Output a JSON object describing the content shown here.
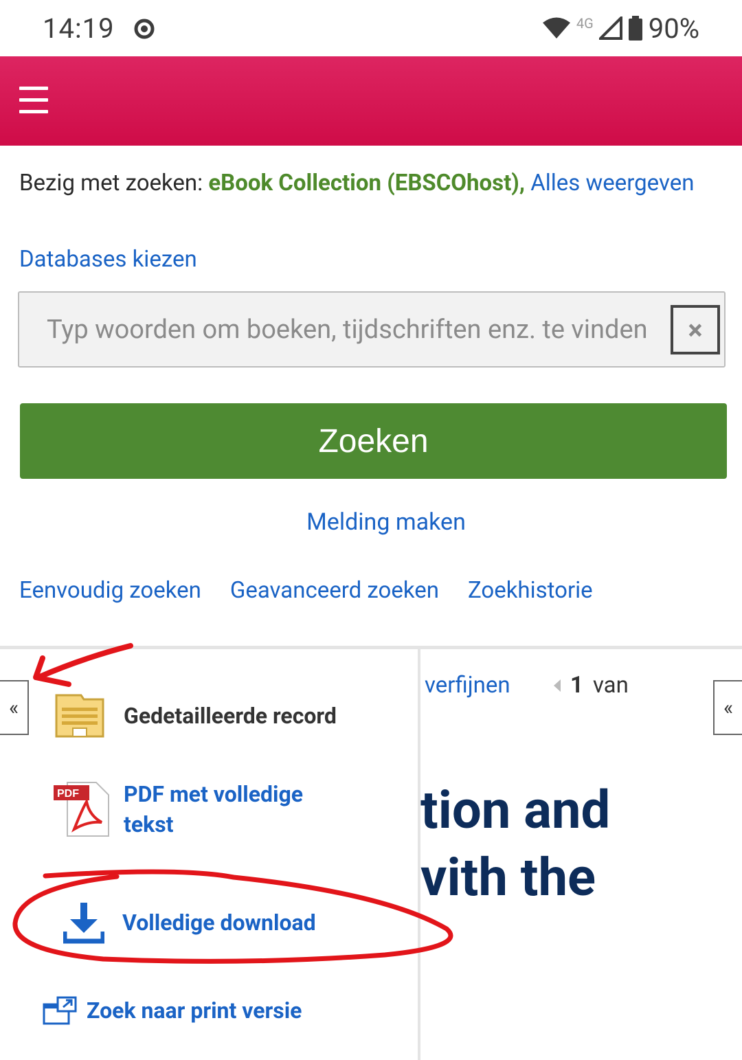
{
  "status_bar": {
    "time": "14:19",
    "network": "4G",
    "battery": "90%"
  },
  "header": {
    "menu_icon": "hamburger-menu-icon",
    "color": "#d4174f"
  },
  "search": {
    "searching_label": "Bezig met zoeken:",
    "database": "eBook Collection (EBSCOhost),",
    "show_all": "Alles weergeven",
    "choose_databases": "Databases kiezen",
    "placeholder": "Typ woorden om boeken, tijdschriften enz. te vinden",
    "clear_label": "×",
    "submit_label": "Zoeken",
    "notify_label": "Melding maken"
  },
  "nav": {
    "basic": "Eenvoudig zoeken",
    "advanced": "Geavanceerd zoeken",
    "history": "Zoekhistorie"
  },
  "result_view": {
    "refine_fragment": "verfijnen",
    "page_current": "1",
    "page_of": "van",
    "title_line1": "tion and",
    "title_line2": "vith the"
  },
  "panel": {
    "collapse_glyph": "«",
    "items": [
      {
        "label": "Gedetailleerde record",
        "icon": "detailed-record-icon"
      },
      {
        "label": "PDF met volledige tekst",
        "icon": "pdf-icon"
      },
      {
        "label": "Volledige download",
        "icon": "download-icon"
      },
      {
        "label": "Zoek naar print versie",
        "icon": "print-version-icon"
      }
    ]
  },
  "colors": {
    "accent_green": "#4e8a32",
    "link_blue": "#1a63c5",
    "annotation_red": "#e2151a"
  }
}
